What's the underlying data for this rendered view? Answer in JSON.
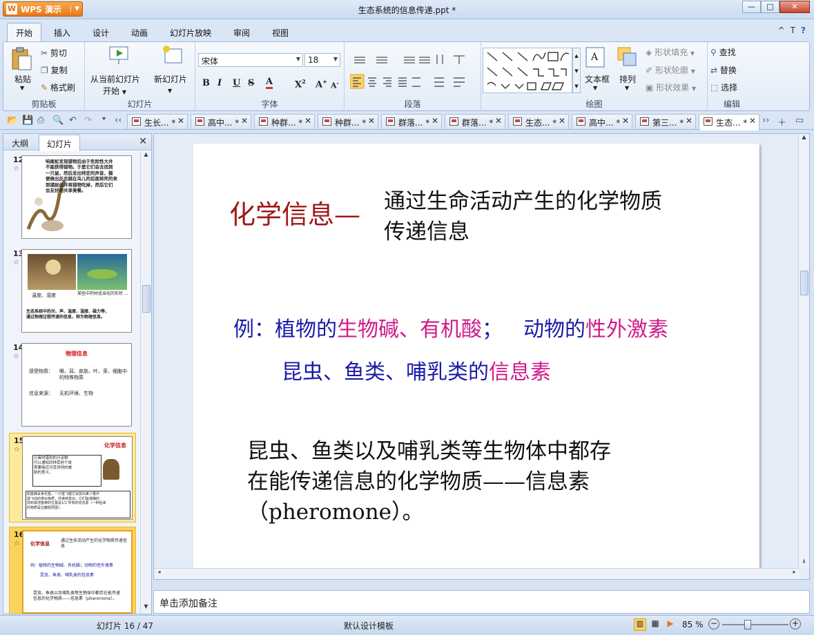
{
  "window": {
    "app_name": "WPS 演示",
    "doc_title": "生态系统的信息传递.ppt *"
  },
  "menu": {
    "tabs": [
      "开始",
      "插入",
      "设计",
      "动画",
      "幻灯片放映",
      "审阅",
      "视图"
    ],
    "right_icons": [
      "^",
      "T",
      "?"
    ]
  },
  "ribbon": {
    "clipboard": {
      "paste": "粘贴",
      "cut": "剪切",
      "copy": "复制",
      "format_painter": "格式刷",
      "label": "剪贴板"
    },
    "slides": {
      "from_current": "从当前幻灯片",
      "start": "开始",
      "new_slide": "新幻灯片",
      "label": "幻灯片"
    },
    "font": {
      "font_name": "宋体",
      "font_size": "18",
      "label": "字体"
    },
    "paragraph": {
      "label": "段落"
    },
    "drawing": {
      "textbox": "文本框",
      "arrange": "排列",
      "shape_fill": "形状填充",
      "shape_outline": "形状轮廓",
      "shape_effects": "形状效果",
      "label": "绘图"
    },
    "edit": {
      "find": "查找",
      "replace": "替换",
      "select": "选择",
      "label": "编辑"
    }
  },
  "doc_tabs": [
    {
      "label": "生长... *"
    },
    {
      "label": "高中... *"
    },
    {
      "label": "种群... *"
    },
    {
      "label": "种群... *"
    },
    {
      "label": "群落... *"
    },
    {
      "label": "群落... *"
    },
    {
      "label": "生态... *"
    },
    {
      "label": "高中... *"
    },
    {
      "label": "第三... *"
    },
    {
      "label": "生态... *"
    }
  ],
  "left_panel": {
    "tab_outline": "大纲",
    "tab_slides": "幻灯片",
    "thumbnails": [
      {
        "num": "12",
        "lines": [
          "响尾蛇发现猎物后由于危险性大并",
          "不能获得猎物。于是它们会去找到",
          "一只鼠，然后发出特定的声音，猫",
          "便做出反应跳在鸟儿的后面将死的来",
          "到捕捉此并将猎物吃掉，然后它们",
          "会友好地共享美餐。"
        ]
      },
      {
        "num": "13",
        "caption_a": "温度、湿度",
        "caption_b": "某些中药材适当化的形状 ...",
        "lines": [
          "生态系统中的光、声、温度、湿度、磁力等，",
          "通过物理过程传递的信息，称为物理信息。"
        ]
      },
      {
        "num": "14",
        "title": "物理信息",
        "row1_label": "感受物质：",
        "row1_value": "眼、耳、皮肤、叶、芽、细胞中的特殊物质",
        "row2_label": "信息来源：",
        "row2_value": "无机环境、生物"
      },
      {
        "num": "15",
        "title": "化学信息",
        "box1": [
          "兴奋的猎豹的分泌物",
          "可以通知同种其他个体",
          "首要接近对其领地的威",
          "胁的意义。"
        ],
        "box2": [
          "如蜜蜂采食花蜜，一只蜜飞越它会放出某少量外",
          "激飞动的类似物质，并继续发出，它们能准确的",
          "找到其他蜜蜂的位置是1/2 所有的信息素（一种后来",
          "的物质是在腹腔周围）。"
        ]
      },
      {
        "num": "16",
        "title": "化学信息",
        "subtitle": "通过生命活动产生的化学物质传递信息",
        "line_ex": "例：植物的生物碱、有机酸；动物的性外激素",
        "line_ex2": "昆虫、鱼类、哺乳类的信息素",
        "body": "昆虫、鱼类以及哺乳类等生物体中都存在能传递信息的化学物质——信息素（pheromone）。"
      }
    ]
  },
  "slide": {
    "title": "化学信息—",
    "subtitle_line1": "通过生命活动产生的化学物质",
    "subtitle_line2": "传递信息",
    "ex_prefix": "例：植物的",
    "ex_plant": "生物碱、有机酸",
    "ex_sep": "；",
    "ex_animal_prefix": "动物的",
    "ex_animal": "性外激素",
    "ex2_prefix": "昆虫、鱼类、哺乳类的",
    "ex2_term": "信息素",
    "body_line1": "昆虫、鱼类以及哺乳类等生物体中都存",
    "body_line2": "在能传递信息的化学物质——信息素",
    "body_line3": "（pheromone）。"
  },
  "notes_placeholder": "单击添加备注",
  "status": {
    "slide_position": "幻灯片 16 / 47",
    "template": "默认设计模板",
    "zoom": "85 %"
  },
  "colors": {
    "title_red": "#a01818",
    "example_blue": "#1a1aa8",
    "highlight_magenta": "#d01a8a",
    "accent_orange": "#e8771a"
  }
}
